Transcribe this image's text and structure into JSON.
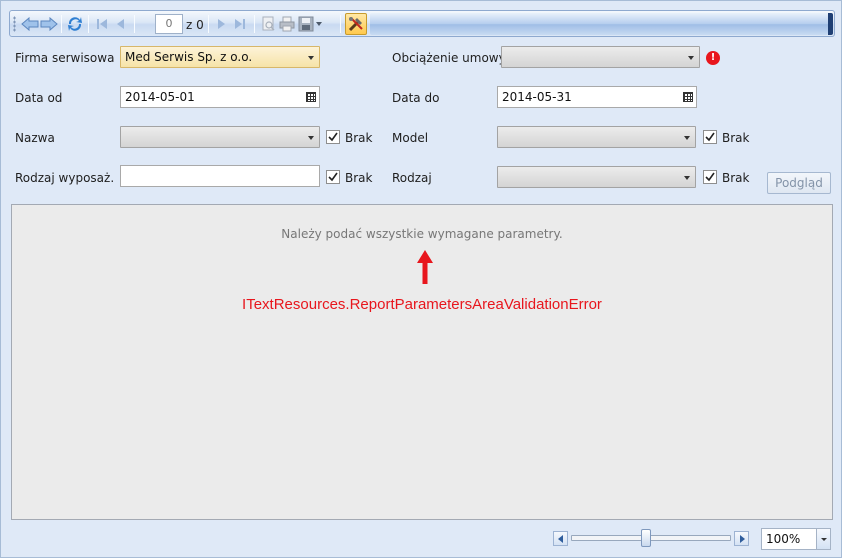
{
  "toolbar": {
    "current_page": "0",
    "page_of": "z 0",
    "icons": [
      "back-icon",
      "forward-icon",
      "refresh-icon",
      "first-page-icon",
      "previous-page-icon",
      "next-page-icon",
      "last-page-icon",
      "print-layout-icon",
      "print-icon",
      "save-icon",
      "dropdown-icon",
      "tools-icon"
    ]
  },
  "params": {
    "firma_label": "Firma serwisowa",
    "firma_value": "Med Serwis Sp. z o.o.",
    "obciazenie_label": "Obciążenie umowy",
    "obciazenie_value": "",
    "data_od_label": "Data od",
    "data_od_value": "2014-05-01",
    "data_do_label": "Data do",
    "data_do_value": "2014-05-31",
    "nazwa_label": "Nazwa",
    "nazwa_value": "",
    "model_label": "Model",
    "model_value": "",
    "rodzaj_wyp_label": "Rodzaj wyposaż.",
    "rodzaj_wyp_value": "",
    "rodzaj_label": "Rodzaj",
    "rodzaj_value": "",
    "brak_label": "Brak",
    "preview_button": "Podgląd",
    "error_glyph": "!"
  },
  "report": {
    "message": "Należy podać wszystkie wymagane parametry.",
    "resource_key": "ITextResources.ReportParametersAreaValidationError"
  },
  "zoom": {
    "value": "100%",
    "slider_fraction": 0.47
  },
  "colors": {
    "error_red": "#e8161d",
    "toolbar_blue": "#c9daf1",
    "report_bg": "#ebebeb"
  }
}
